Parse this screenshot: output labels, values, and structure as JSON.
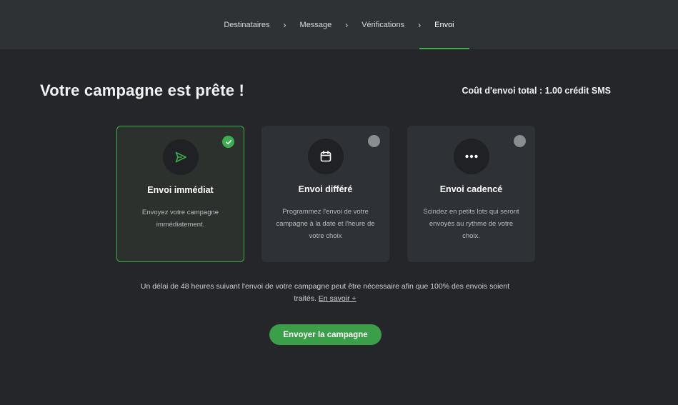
{
  "steps": [
    {
      "label": "Destinataires"
    },
    {
      "label": "Message"
    },
    {
      "label": "Vérifications"
    },
    {
      "label": "Envoi"
    }
  ],
  "step_separator": "›",
  "page_title": "Votre campagne est prête !",
  "cost": "Coût d'envoi total : 1.00 crédit SMS",
  "cards": [
    {
      "title": "Envoi immédiat",
      "description": "Envoyez votre campagne immédiatement.",
      "icon": "send-icon",
      "selected": true
    },
    {
      "title": "Envoi différé",
      "description": "Programmez l'envoi de votre campagne à la date et l'heure de votre choix",
      "icon": "calendar-icon",
      "selected": false
    },
    {
      "title": "Envoi cadencé",
      "description": "Scindez en petits lots qui seront envoyés au rythme de votre choix.",
      "icon": "ellipsis-icon",
      "selected": false
    }
  ],
  "notice": {
    "text": "Un délai de 48 heures suivant l'envoi de votre campagne peut être nécessaire afin que 100% des envois soient traités.",
    "link": "En savoir +"
  },
  "send_button": "Envoyer la campagne",
  "colors": {
    "accent": "#3dae4f",
    "background": "#242629",
    "header": "#2e3235",
    "card": "#2e3135"
  }
}
